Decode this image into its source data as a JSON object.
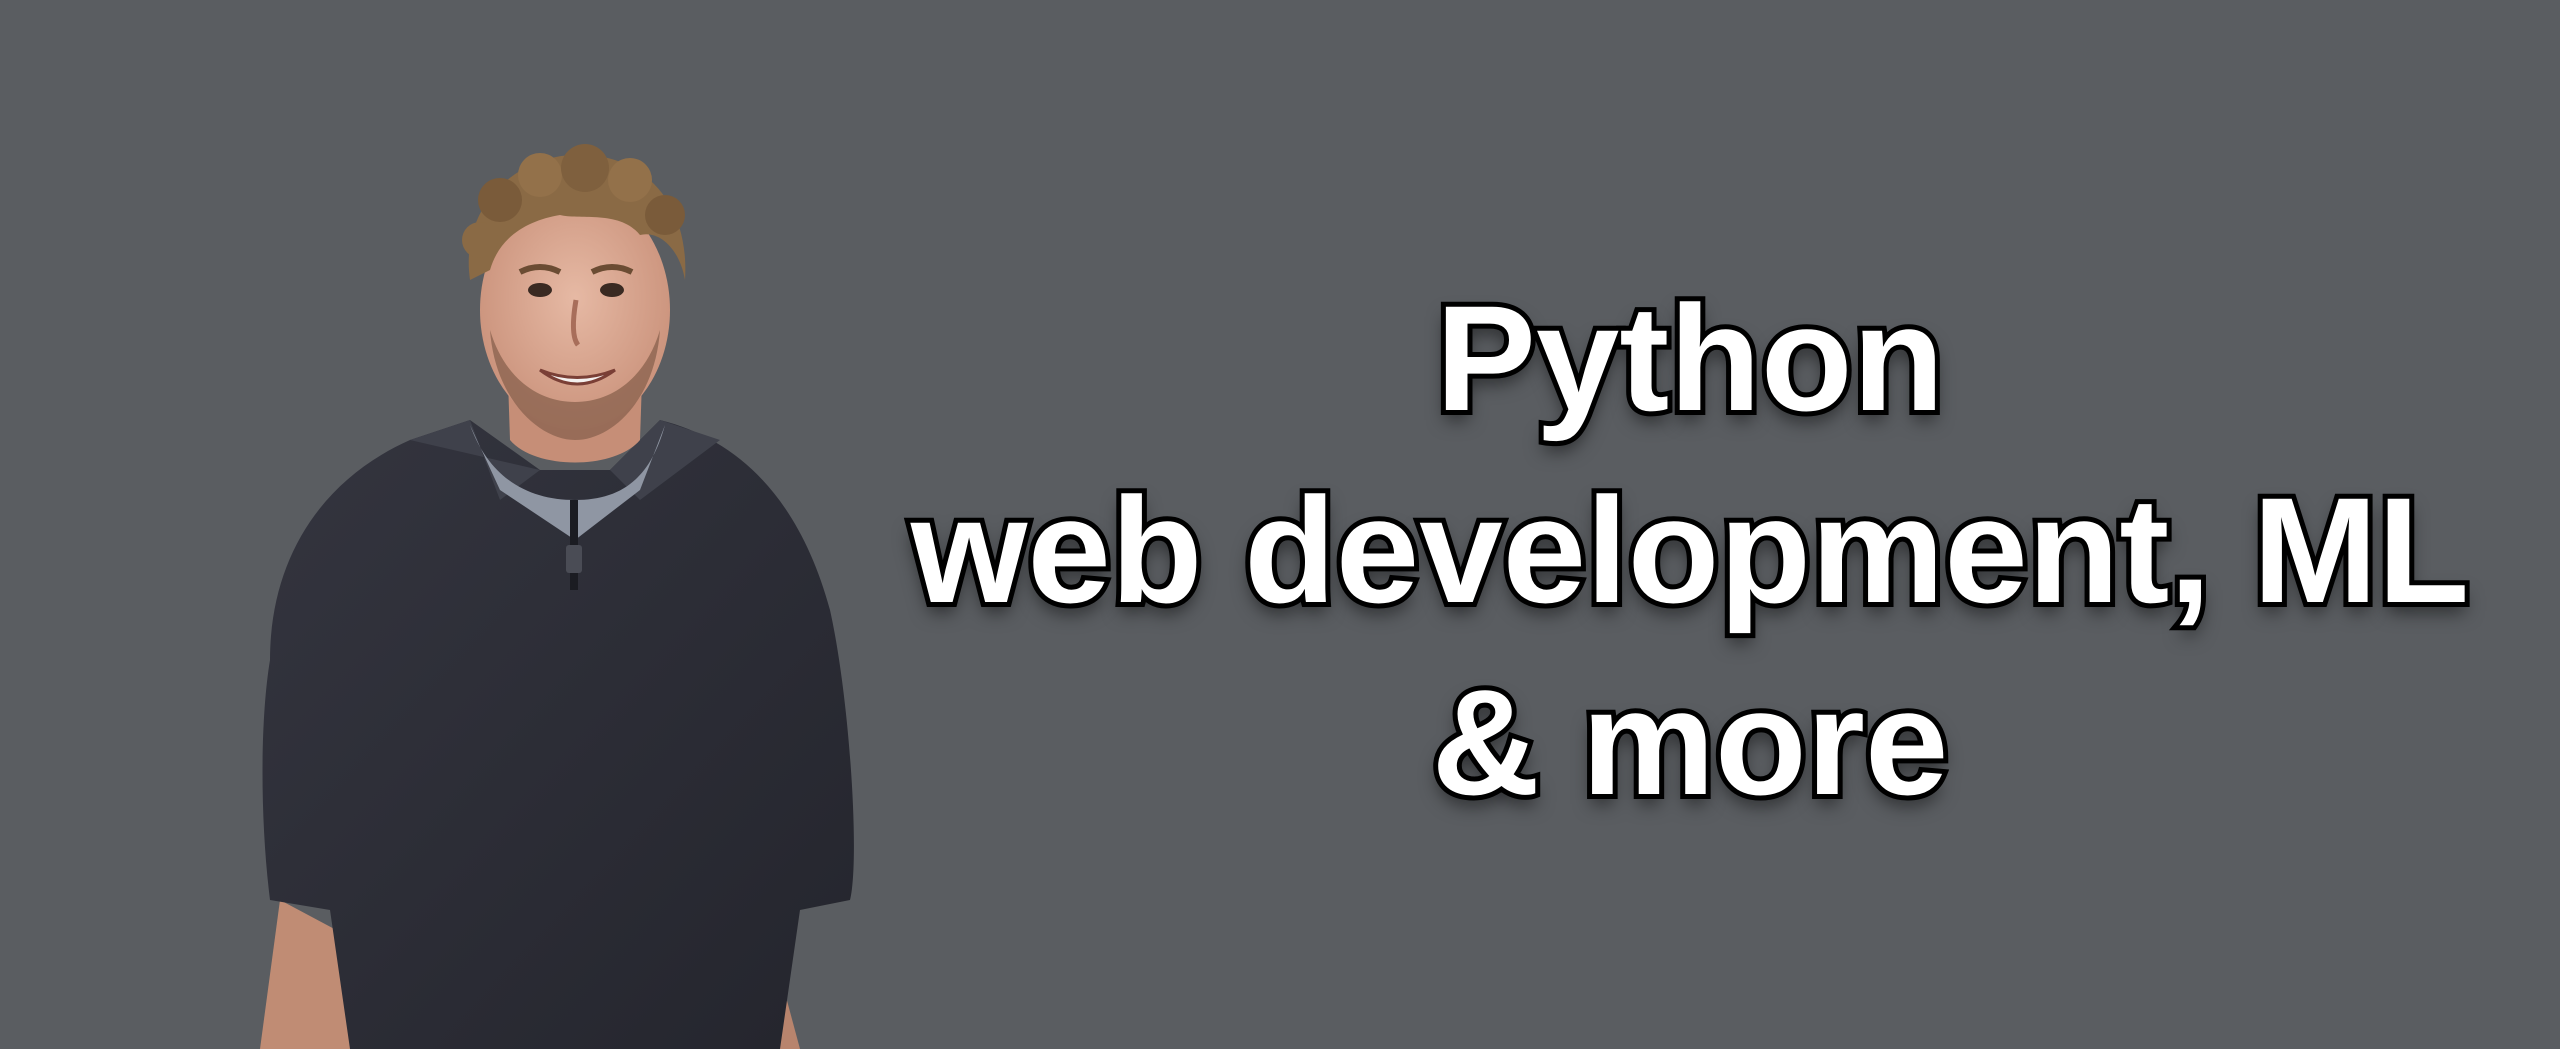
{
  "headline": {
    "line1": "Python",
    "line2": "web development, ML",
    "line3": "& more"
  },
  "colors": {
    "background": "#5a5d61",
    "text_fill": "#ffffff",
    "text_outline": "#000000",
    "sweater": "#2b2c35",
    "tshirt": "#8f96a3",
    "skin": "#d9a894",
    "hair": "#8a6a45"
  },
  "portrait": {
    "description_icon": "person-portrait-icon"
  }
}
